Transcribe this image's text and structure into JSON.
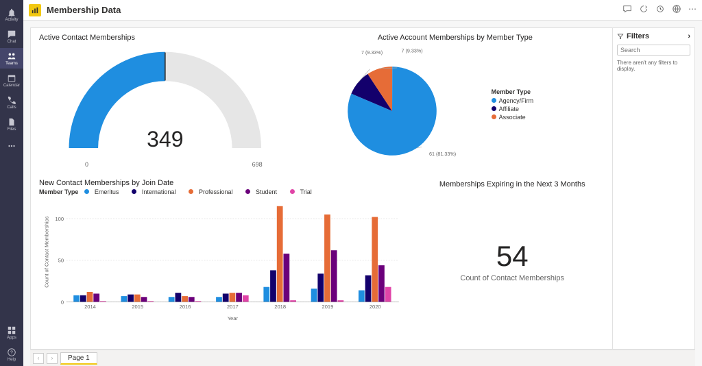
{
  "rail": {
    "items": [
      {
        "name": "activity",
        "label": "Activity"
      },
      {
        "name": "chat",
        "label": "Chat"
      },
      {
        "name": "teams",
        "label": "Teams",
        "active": true
      },
      {
        "name": "calendar",
        "label": "Calendar"
      },
      {
        "name": "calls",
        "label": "Calls"
      },
      {
        "name": "files",
        "label": "Files"
      },
      {
        "name": "more",
        "label": ""
      }
    ],
    "bottom": [
      {
        "name": "apps",
        "label": "Apps"
      },
      {
        "name": "help",
        "label": "Help"
      }
    ]
  },
  "header": {
    "title": "Membership Data"
  },
  "filters": {
    "title": "Filters",
    "search_placeholder": "Search",
    "empty": "There aren't any filters to display."
  },
  "tabs": {
    "page1": "Page 1"
  },
  "gauge": {
    "title": "Active Contact Memberships",
    "value": "349",
    "min": "0",
    "max": "698"
  },
  "pie": {
    "title": "Active Account Memberships by Member Type",
    "legend_title": "Member Type",
    "legend": [
      "Agency/Firm",
      "Affiliate",
      "Associate"
    ]
  },
  "bar": {
    "title": "New Contact Memberships by Join Date",
    "legend_title": "Member Type",
    "legend": [
      "Emeritus",
      "International",
      "Professional",
      "Student",
      "Trial"
    ],
    "ylabel": "Count of Contact Memberships",
    "xlabel": "Year"
  },
  "card": {
    "title": "Memberships Expiring in the Next 3 Months",
    "value": "54",
    "label": "Count of Contact Memberships"
  },
  "chart_data": [
    {
      "type": "gauge",
      "title": "Active Contact Memberships",
      "value": 349,
      "min": 0,
      "max": 698
    },
    {
      "type": "pie",
      "title": "Active Account Memberships by Member Type",
      "series": [
        {
          "name": "Agency/Firm",
          "value": 61,
          "percent": 81.33,
          "color": "#1f8ee0"
        },
        {
          "name": "Affiliate",
          "value": 7,
          "percent": 9.33,
          "color": "#13006c"
        },
        {
          "name": "Associate",
          "value": 7,
          "percent": 9.33,
          "color": "#e66c37"
        }
      ],
      "labels": [
        "61 (81.33%)",
        "7 (9.33%)",
        "7 (9.33%)"
      ]
    },
    {
      "type": "bar",
      "title": "New Contact Memberships by Join Date",
      "xlabel": "Year",
      "ylabel": "Count of Contact Memberships",
      "categories": [
        "2014",
        "2015",
        "2016",
        "2017",
        "2018",
        "2019",
        "2020"
      ],
      "ylim": [
        0,
        120
      ],
      "yticks": [
        0,
        50,
        100
      ],
      "colors": {
        "Emeritus": "#1f8ee0",
        "International": "#13006c",
        "Professional": "#e66c37",
        "Student": "#6b007b",
        "Trial": "#e044a7"
      },
      "series": [
        {
          "name": "Emeritus",
          "values": [
            8,
            7,
            6,
            6,
            18,
            16,
            14
          ]
        },
        {
          "name": "International",
          "values": [
            8,
            9,
            11,
            10,
            38,
            34,
            32
          ]
        },
        {
          "name": "Professional",
          "values": [
            12,
            9,
            7,
            11,
            115,
            105,
            102
          ]
        },
        {
          "name": "Student",
          "values": [
            10,
            6,
            6,
            11,
            58,
            62,
            44
          ]
        },
        {
          "name": "Trial",
          "values": [
            1,
            1,
            1,
            8,
            2,
            2,
            18
          ]
        }
      ]
    },
    {
      "type": "card",
      "title": "Memberships Expiring in the Next 3 Months",
      "value": 54,
      "label": "Count of Contact Memberships"
    }
  ]
}
